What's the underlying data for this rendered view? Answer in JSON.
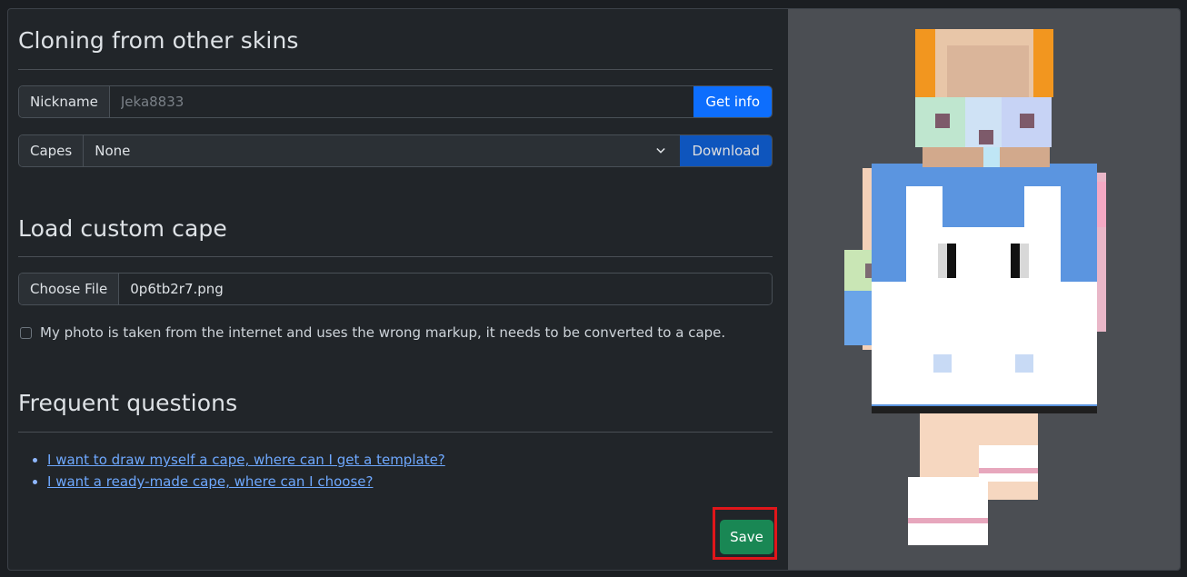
{
  "cloning": {
    "title": "Cloning from other skins",
    "nickname_label": "Nickname",
    "nickname_value": "Jeka8833",
    "get_info_label": "Get info",
    "capes_label": "Capes",
    "capes_selected": "None",
    "download_label": "Download"
  },
  "custom_cape": {
    "title": "Load custom cape",
    "choose_file_label": "Choose File",
    "file_name": "0p6tb2r7.png",
    "convert_checkbox_label": "My photo is taken from the internet and uses the wrong markup, it needs to be converted to a cape."
  },
  "faq": {
    "title": "Frequent questions",
    "links": [
      "I want to draw myself a cape, where can I get a template?",
      "I want a ready-made cape, where can I choose?"
    ]
  },
  "save_label": "Save",
  "colors": {
    "primary": "#0d6efd",
    "success": "#198754",
    "highlight": "#e0161a",
    "preview_bg": "#4b4e53"
  }
}
